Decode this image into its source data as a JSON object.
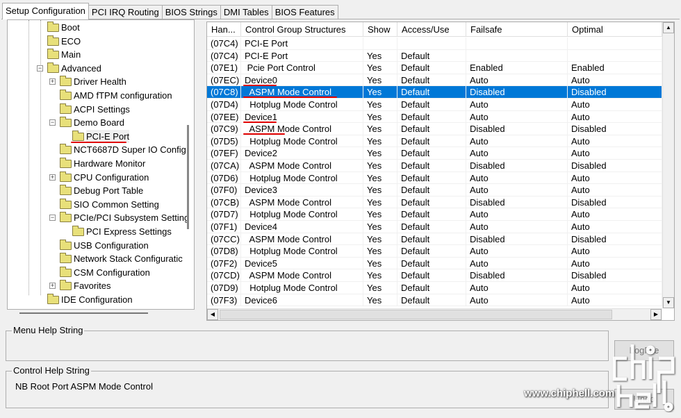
{
  "tabs": [
    {
      "label": "Setup Configuration",
      "active": true
    },
    {
      "label": "PCI IRQ Routing"
    },
    {
      "label": "BIOS Strings"
    },
    {
      "label": "DMI Tables"
    },
    {
      "label": "BIOS Features"
    }
  ],
  "tree": [
    {
      "label": "Boot",
      "level": 0
    },
    {
      "label": "ECO",
      "level": 0
    },
    {
      "label": "Main",
      "level": 0
    },
    {
      "label": "Advanced",
      "level": 0,
      "expander": "minus"
    },
    {
      "label": "Driver Health",
      "level": 1,
      "expander": "plus"
    },
    {
      "label": "AMD fTPM configuration",
      "level": 1
    },
    {
      "label": "ACPI Settings",
      "level": 1
    },
    {
      "label": "Demo Board",
      "level": 1,
      "expander": "minus"
    },
    {
      "label": "PCI-E Port",
      "level": 2,
      "selected": true,
      "red_underline": true,
      "open": true
    },
    {
      "label": "NCT6687D Super IO Config",
      "level": 1
    },
    {
      "label": "Hardware Monitor",
      "level": 1
    },
    {
      "label": "CPU Configuration",
      "level": 1,
      "expander": "plus"
    },
    {
      "label": "Debug Port Table",
      "level": 1
    },
    {
      "label": "SIO Common Setting",
      "level": 1
    },
    {
      "label": "PCIe/PCI Subsystem Setting",
      "level": 1,
      "expander": "minus"
    },
    {
      "label": "PCI Express Settings",
      "level": 2
    },
    {
      "label": "USB Configuration",
      "level": 1
    },
    {
      "label": "Network Stack Configuratic",
      "level": 1
    },
    {
      "label": "CSM Configuration",
      "level": 1
    },
    {
      "label": "Favorites",
      "level": 1,
      "expander": "plus"
    },
    {
      "label": "IDE Configuration",
      "level": 0
    }
  ],
  "table": {
    "columns": [
      "Han...",
      "Control Group Structures",
      "Show",
      "Access/Use",
      "Failsafe",
      "Optimal"
    ],
    "rows": [
      {
        "cells": [
          "(07C4)",
          "PCI-E Port",
          "",
          "",
          "",
          ""
        ]
      },
      {
        "cells": [
          "(07C4)",
          "PCI-E Port",
          "Yes",
          "Default",
          "",
          ""
        ]
      },
      {
        "cells": [
          "(07E1)",
          " Pcie Port Control",
          "Yes",
          "Default",
          "Enabled",
          "Enabled"
        ]
      },
      {
        "cells": [
          "(07EC)",
          "Device0",
          "Yes",
          "Default",
          "Auto",
          "Auto"
        ],
        "red_underline": true
      },
      {
        "cells": [
          "(07C8)",
          "  ASPM Mode Control",
          "Yes",
          "Default",
          "Disabled",
          "Disabled"
        ],
        "selected": true,
        "red_underline": true
      },
      {
        "cells": [
          "(07D4)",
          "  Hotplug Mode Control",
          "Yes",
          "Default",
          "Auto",
          "Auto"
        ]
      },
      {
        "cells": [
          "(07EE)",
          "Device1",
          "Yes",
          "Default",
          "Auto",
          "Auto"
        ],
        "red_underline": true
      },
      {
        "cells": [
          "(07C9)",
          "  ASPM Mode Control",
          "Yes",
          "Default",
          "Disabled",
          "Disabled"
        ],
        "red_underline": true
      },
      {
        "cells": [
          "(07D5)",
          "  Hotplug Mode Control",
          "Yes",
          "Default",
          "Auto",
          "Auto"
        ]
      },
      {
        "cells": [
          "(07EF)",
          "Device2",
          "Yes",
          "Default",
          "Auto",
          "Auto"
        ]
      },
      {
        "cells": [
          "(07CA)",
          "  ASPM Mode Control",
          "Yes",
          "Default",
          "Disabled",
          "Disabled"
        ]
      },
      {
        "cells": [
          "(07D6)",
          "  Hotplug Mode Control",
          "Yes",
          "Default",
          "Auto",
          "Auto"
        ]
      },
      {
        "cells": [
          "(07F0)",
          "Device3",
          "Yes",
          "Default",
          "Auto",
          "Auto"
        ]
      },
      {
        "cells": [
          "(07CB)",
          "  ASPM Mode Control",
          "Yes",
          "Default",
          "Disabled",
          "Disabled"
        ]
      },
      {
        "cells": [
          "(07D7)",
          "  Hotplug Mode Control",
          "Yes",
          "Default",
          "Auto",
          "Auto"
        ]
      },
      {
        "cells": [
          "(07F1)",
          "Device4",
          "Yes",
          "Default",
          "Auto",
          "Auto"
        ]
      },
      {
        "cells": [
          "(07CC)",
          "  ASPM Mode Control",
          "Yes",
          "Default",
          "Disabled",
          "Disabled"
        ]
      },
      {
        "cells": [
          "(07D8)",
          "  Hotplug Mode Control",
          "Yes",
          "Default",
          "Auto",
          "Auto"
        ]
      },
      {
        "cells": [
          "(07F2)",
          "Device5",
          "Yes",
          "Default",
          "Auto",
          "Auto"
        ]
      },
      {
        "cells": [
          "(07CD)",
          "  ASPM Mode Control",
          "Yes",
          "Default",
          "Disabled",
          "Disabled"
        ]
      },
      {
        "cells": [
          "(07D9)",
          "  Hotplug Mode Control",
          "Yes",
          "Default",
          "Auto",
          "Auto"
        ]
      },
      {
        "cells": [
          "(07F3)",
          "Device6",
          "Yes",
          "Default",
          "Auto",
          "Auto"
        ]
      }
    ]
  },
  "menu_help": {
    "label": "Menu Help String",
    "text": ""
  },
  "control_help": {
    "label": "Control Help String",
    "text": "NB Root Port ASPM Mode Control"
  },
  "buttons": {
    "logfile": "LogFile",
    "undo": "Undo"
  },
  "watermark": {
    "text": "www.chiphell.com",
    "logo": "chip hell"
  },
  "colors": {
    "selection": "#0078d7",
    "annotation": "#e00000",
    "folder": "#e8e07a"
  }
}
